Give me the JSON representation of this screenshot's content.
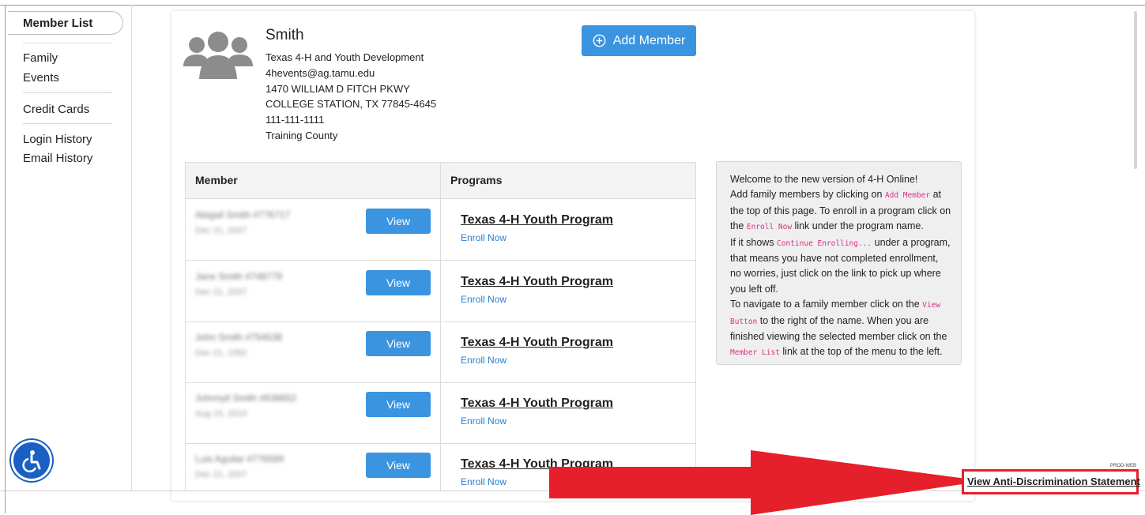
{
  "sidebar": {
    "active_item": "Member List",
    "items": [
      "Family",
      "Events",
      "Credit Cards",
      "Login History",
      "Email History"
    ]
  },
  "family": {
    "name": "Smith",
    "org": "Texas 4-H and Youth Development",
    "email": "4hevents@ag.tamu.edu",
    "address1": "1470 WILLIAM D FITCH PKWY",
    "address2": "COLLEGE STATION, TX 77845-4645",
    "phone": "111-111-1111",
    "county": "Training County"
  },
  "add_member_label": "Add Member",
  "table": {
    "headers": [
      "Member",
      "Programs"
    ],
    "view_label": "View",
    "enroll_label": "Enroll Now",
    "rows": [
      {
        "member": "Abigail Smith #776717",
        "dob": "Dec 21, 2007",
        "program": "Texas 4-H Youth Program"
      },
      {
        "member": "Jane Smith #748779",
        "dob": "Dec 21, 2007",
        "program": "Texas 4-H Youth Program"
      },
      {
        "member": "John Smith #754538",
        "dob": "Dec 21, 1992",
        "program": "Texas 4-H Youth Program"
      },
      {
        "member": "Johnnyll Smith #638652",
        "dob": "Aug 15, 2010",
        "program": "Texas 4-H Youth Program"
      },
      {
        "member": "Luis Aguilar #776589",
        "dob": "Dec 21, 2007",
        "program": "Texas 4-H Youth Program"
      }
    ]
  },
  "infobox": {
    "l1": "Welcome to the new version of 4-H Online!",
    "l2a": "Add family members by clicking on ",
    "l2code": "Add Member",
    "l2b": " at the top of this page. To enroll in a program click on the ",
    "l3code": "Enroll Now",
    "l3b": " link under the program name.",
    "l4a": "If it shows ",
    "l4code": "Continue Enrolling...",
    "l4b": " under a program, that means you have not completed enrollment, no worries, just click on the link to pick up where you left off.",
    "l5a": "To navigate to a family member click on the ",
    "l5code": "View Button",
    "l5b": " to the right of the name. When you are finished viewing the selected member click on the ",
    "l6code": "Member List",
    "l6b": " link at the top of the menu to the left."
  },
  "footer": {
    "anti_discrimination": "View Anti-Discrimination Statement",
    "env": "PROD-WEB"
  },
  "colors": {
    "primary_button": "#3a94e0",
    "link": "#2a7fd1",
    "code": "#d63384",
    "arrow": "#e5202a",
    "accessibility": "#1a5fc4"
  },
  "icons": [
    "family-avatar-icon",
    "plus-circle-icon",
    "accessibility-icon",
    "red-arrow-annotation"
  ]
}
